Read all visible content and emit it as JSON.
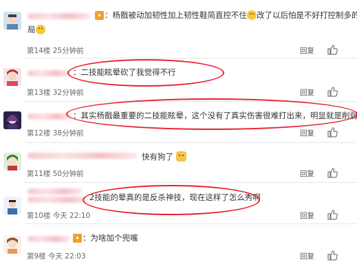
{
  "reply_label": "回复",
  "comments": [
    {
      "text_line1": "：杨戬被动加韧性加上韧性鞋简直控不住",
      "text_mid": "改了以后怕是不好打控制多的",
      "text_line2": "局",
      "floor": "第14楼",
      "time": "25分钟前"
    },
    {
      "text": "：二技能眩晕砍了我觉得不行",
      "floor": "第13楼",
      "time": "32分钟前"
    },
    {
      "text": "：其实杨戬最重要的二技能眩晕，这个没有了真实伤害很难打出来，明显就是削弱了",
      "floor": "第12楼",
      "time": "38分钟前"
    },
    {
      "text": "快有狗了",
      "floor": "第11楼",
      "time": "50分钟前"
    },
    {
      "text": "2技能的晕真的是反杀神技，现在这样了怎么秀啊",
      "floor": "第10楼",
      "time": "今天 22:10"
    },
    {
      "text": "：为啥加个兜嘴",
      "floor": "第9楼",
      "time": "今天 22:03"
    }
  ],
  "colors": {
    "highlight_oval": "#e8202e",
    "badge": "#f0a030",
    "blurred_name": "#f7c9cf"
  },
  "icons": [
    "avatar",
    "vip-badge",
    "emoji-icon",
    "dog-emoji-icon",
    "thumbs-up-icon"
  ]
}
